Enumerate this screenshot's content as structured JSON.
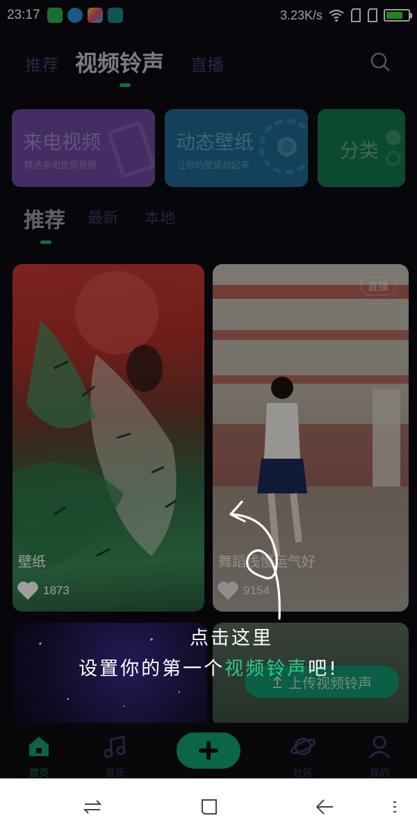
{
  "status_bar": {
    "time": "23:17",
    "net_speed": "3.23K/s",
    "battery_level": 0.75,
    "notification_icons": [
      "wechat-icon",
      "sync-icon",
      "gallery-icon",
      "usb-icon"
    ]
  },
  "top_tabs": {
    "items": [
      "推荐",
      "视频铃声",
      "直播"
    ],
    "active_index": 1
  },
  "category_cards": [
    {
      "title": "来电视频",
      "subtitle": "精选来电优质视频",
      "color": "#6c4aa0"
    },
    {
      "title": "动态壁纸",
      "subtitle": "让你的壁纸动起来",
      "color": "#1f6a94"
    },
    {
      "title": "分类",
      "subtitle": "",
      "color": "#14784e"
    }
  ],
  "sub_tabs": {
    "items": [
      "推荐",
      "最新",
      "本地"
    ],
    "active_index": 0
  },
  "media_items": [
    {
      "caption": "壁纸",
      "likes": "1873",
      "badge": ""
    },
    {
      "caption": "舞蹈浅慢运气好",
      "likes": "9154",
      "badge": "直播"
    },
    {
      "caption": "",
      "likes": "",
      "badge": ""
    },
    {
      "caption": "",
      "likes": "",
      "badge": "",
      "action_label": "上传视频铃声"
    }
  ],
  "guide": {
    "line1": "点击这里",
    "line2_prefix": "设置你的第一个",
    "line2_highlight": "视频铃声",
    "line2_suffix": "吧!"
  },
  "bottom_nav": {
    "items": [
      {
        "label": "首页",
        "icon": "home-icon"
      },
      {
        "label": "音乐",
        "icon": "music-icon"
      },
      {
        "label": "",
        "icon": "plus-icon"
      },
      {
        "label": "社区",
        "icon": "planet-icon"
      },
      {
        "label": "我的",
        "icon": "profile-icon"
      }
    ],
    "active_index": 0
  },
  "colors": {
    "accent": "#12a474",
    "highlight": "#29c98c",
    "background": "#0c0c12"
  }
}
